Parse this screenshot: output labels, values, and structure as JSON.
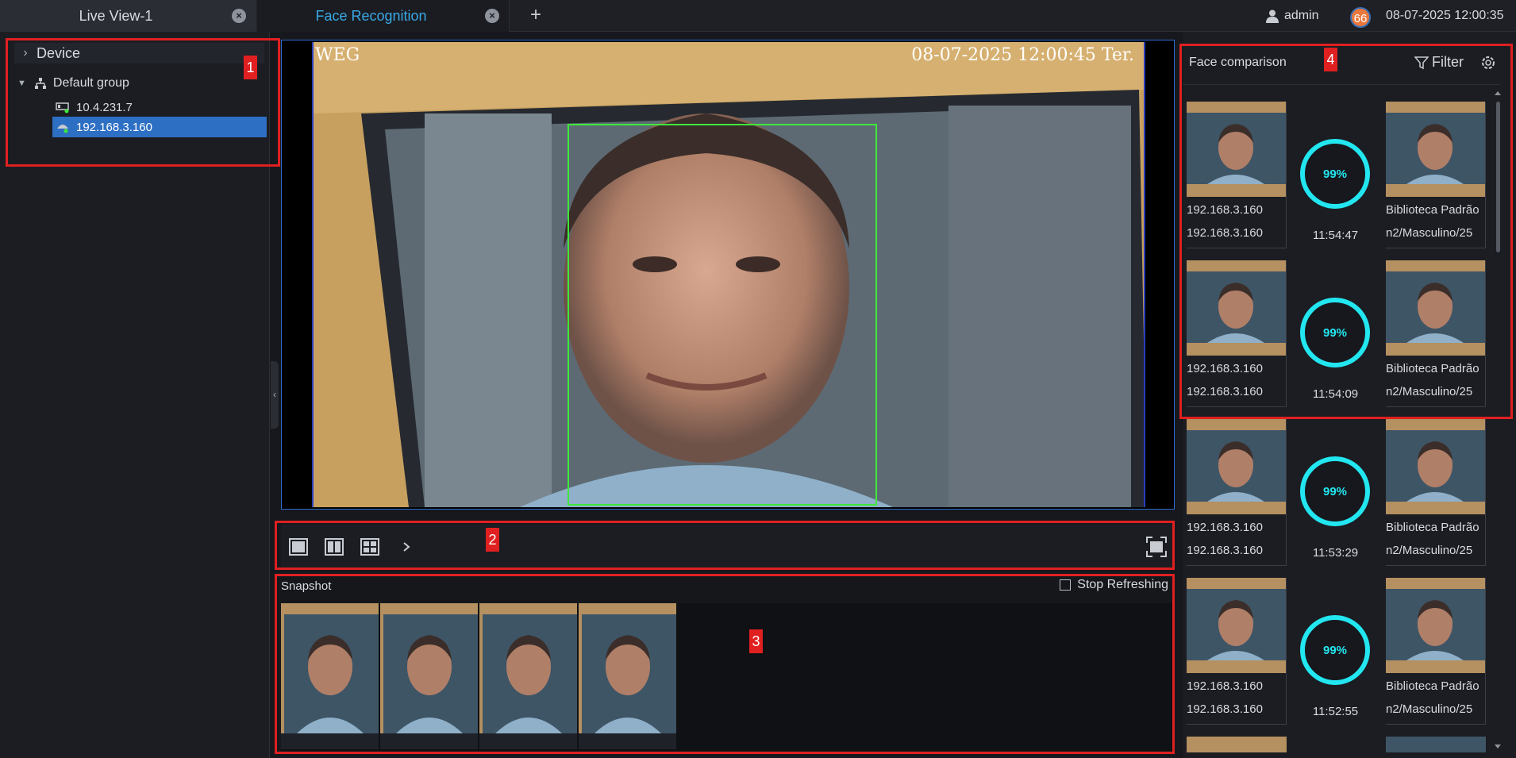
{
  "tabs": [
    {
      "label": "Live View-1"
    },
    {
      "label": "Face Recognition"
    }
  ],
  "header": {
    "user": "admin",
    "badge_count": "66",
    "datetime": "08-07-2025 12:00:35"
  },
  "device_tree": {
    "title": "Device",
    "group": "Default group",
    "devices": [
      {
        "label": "10.4.231.7"
      },
      {
        "label": "192.168.3.160"
      }
    ]
  },
  "video": {
    "osd_left": "WEG",
    "osd_right": "08-07-2025 12:00:45 Ter."
  },
  "snapshot": {
    "title": "Snapshot",
    "stop_refreshing": "Stop Refreshing"
  },
  "face_comparison": {
    "title": "Face comparison",
    "filter_label": "Filter",
    "items": [
      {
        "ip1": "192.168.3.160",
        "ip2": "192.168.3.160",
        "lib1": "Biblioteca Padrão",
        "lib2": "n2/Masculino/25",
        "score": "99%",
        "time": "11:54:47"
      },
      {
        "ip1": "192.168.3.160",
        "ip2": "192.168.3.160",
        "lib1": "Biblioteca Padrão",
        "lib2": "n2/Masculino/25",
        "score": "99%",
        "time": "11:54:09"
      },
      {
        "ip1": "192.168.3.160",
        "ip2": "192.168.3.160",
        "lib1": "Biblioteca Padrão",
        "lib2": "n2/Masculino/25",
        "score": "99%",
        "time": "11:53:29"
      },
      {
        "ip1": "192.168.3.160",
        "ip2": "192.168.3.160",
        "lib1": "Biblioteca Padrão",
        "lib2": "n2/Masculino/25",
        "score": "99%",
        "time": "11:52:55"
      }
    ]
  },
  "annotations": [
    "1",
    "2",
    "3",
    "4"
  ],
  "colors": {
    "accent": "#3aa8e6",
    "selected": "#2d6fc3",
    "score_ring": "#22e6f0",
    "face_box": "#3ee83a",
    "annotation": "#e02020"
  }
}
